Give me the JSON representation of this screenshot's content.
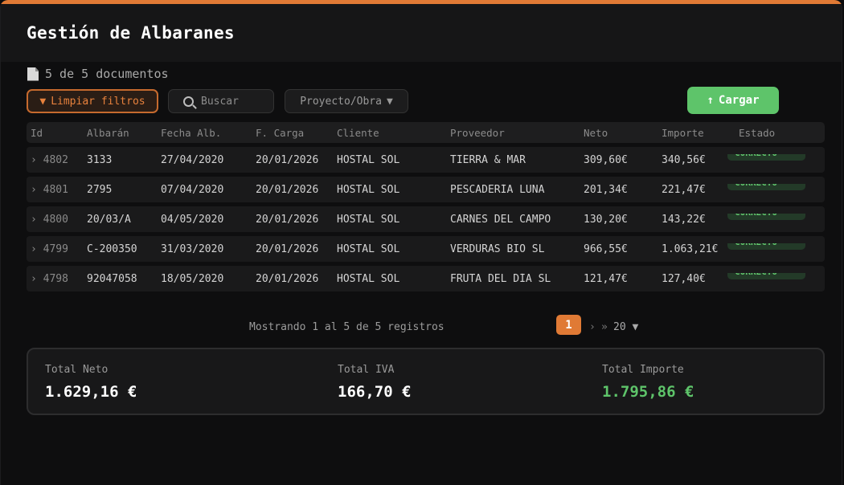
{
  "title": "Gestión de Albaranes",
  "doc_count": "5 de 5 documentos",
  "toolbar": {
    "clear_label": "Limpiar filtros",
    "clear_glyph": "▼",
    "search_placeholder": "Buscar",
    "project_label": "Proyecto/Obra",
    "project_caret": "▼",
    "load_label": "Cargar",
    "load_glyph": "↑"
  },
  "columns": [
    "Id",
    "Albarán",
    "Fecha Alb.",
    "F. Carga",
    "Cliente",
    "Proveedor",
    "Neto",
    "Importe",
    "Estado"
  ],
  "rows": [
    {
      "id": "4802",
      "albaran": "3133",
      "fecha_alb": "27/04/2020",
      "f_carga": "20/01/2026",
      "cliente": "HOSTAL SOL",
      "proveedor": "TIERRA & MAR",
      "neto": "309,60€",
      "importe": "340,56€",
      "estado": "CORRECTO"
    },
    {
      "id": "4801",
      "albaran": "2795",
      "fecha_alb": "07/04/2020",
      "f_carga": "20/01/2026",
      "cliente": "HOSTAL SOL",
      "proveedor": "PESCADERÍA LUNA",
      "neto": "201,34€",
      "importe": "221,47€",
      "estado": "CORRECTO"
    },
    {
      "id": "4800",
      "albaran": "20/03/A",
      "fecha_alb": "04/05/2020",
      "f_carga": "20/01/2026",
      "cliente": "HOSTAL SOL",
      "proveedor": "CARNES DEL CAMPO",
      "neto": "130,20€",
      "importe": "143,22€",
      "estado": "CORRECTO"
    },
    {
      "id": "4799",
      "albaran": "C-200350",
      "fecha_alb": "31/03/2020",
      "f_carga": "20/01/2026",
      "cliente": "HOSTAL SOL",
      "proveedor": "VERDURAS BIO SL",
      "neto": "966,55€",
      "importe": "1.063,21€",
      "estado": "CORRECTO"
    },
    {
      "id": "4798",
      "albaran": "92047058",
      "fecha_alb": "18/05/2020",
      "f_carga": "20/01/2026",
      "cliente": "HOSTAL SOL",
      "proveedor": "FRUTA DEL DÍA SL",
      "neto": "121,47€",
      "importe": "127,40€",
      "estado": "CORRECTO"
    }
  ],
  "pagination": {
    "showing": "Mostrando 1 al 5 de 5 registros",
    "current_page": "1",
    "next": "›",
    "last": "»",
    "page_size": "20 ▼"
  },
  "totals": {
    "neto_label": "Total Neto",
    "neto_value": "1.629,16 €",
    "iva_label": "Total IVA",
    "iva_value": "166,70 €",
    "importe_label": "Total Importe",
    "importe_value": "1.795,86 €"
  },
  "colors": {
    "accent": "#e07a35",
    "success": "#5ec46a"
  }
}
